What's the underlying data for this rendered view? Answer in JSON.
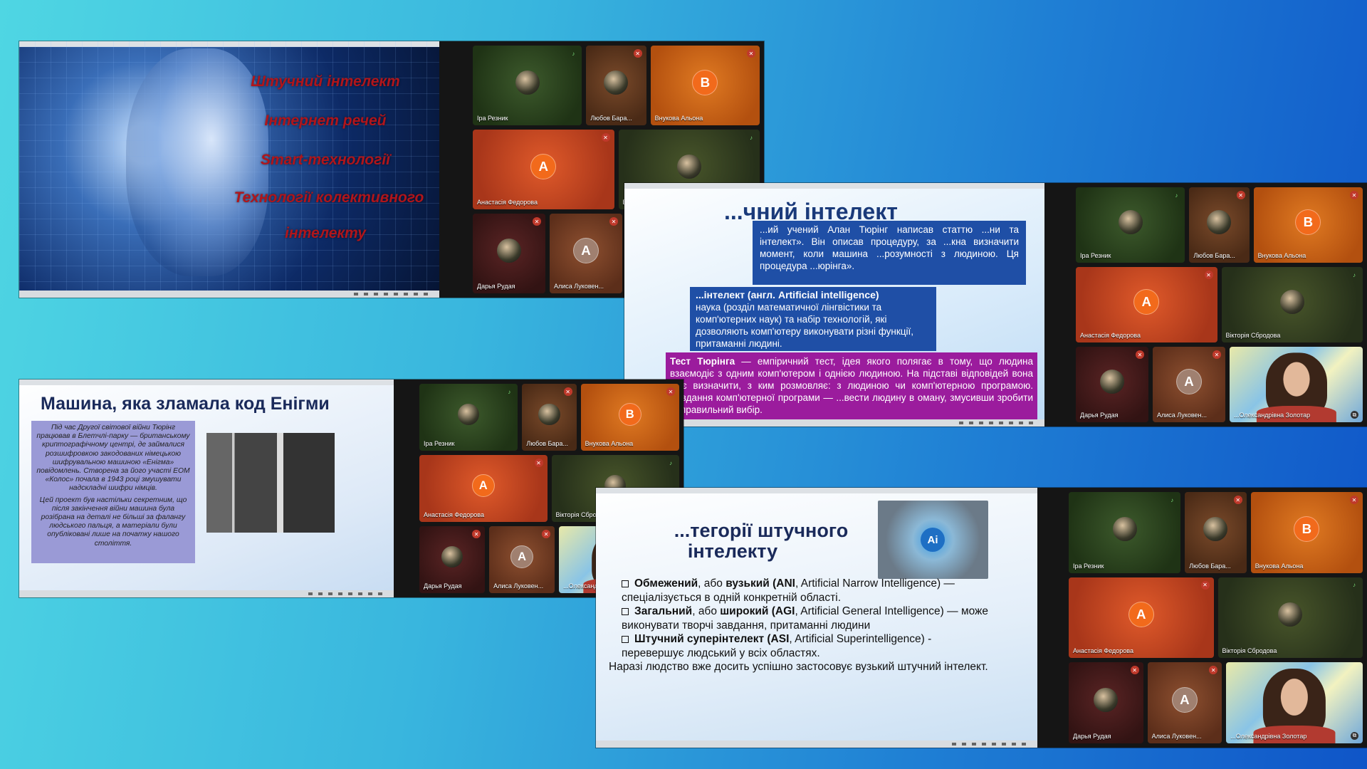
{
  "participants": [
    {
      "name": "Іра Резник",
      "color": "green",
      "kind": "photo",
      "mic": "on"
    },
    {
      "name": "Любов Бара...",
      "color": "brown",
      "kind": "photo",
      "mic": "off"
    },
    {
      "name": "Внукова Альона",
      "color": "orange",
      "kind": "letter",
      "letter": "В",
      "mic": "off"
    },
    {
      "name": "Анастасія Федорова",
      "color": "red",
      "kind": "letter",
      "letter": "А",
      "mic": "off"
    },
    {
      "name": "Вікторія Сбродова",
      "color": "olive",
      "kind": "photo",
      "mic": "on"
    },
    {
      "name": "Дарья Рудая",
      "color": "maroon",
      "kind": "photo",
      "mic": "off"
    },
    {
      "name": "Алиса Луковен...",
      "color": "rust",
      "kind": "letter",
      "letter": "А",
      "mic": "off"
    },
    {
      "name": "...Олександрівна Золотар",
      "color": "cam",
      "kind": "cam",
      "mic": "none"
    }
  ],
  "slide1": {
    "lines": [
      "Штучний інтелект",
      "Інтернет речей",
      "Smart-технології",
      "Технології колективного",
      "інтелекту"
    ]
  },
  "slide2": {
    "title": "...чний інтелект",
    "box1": "...ий учений Алан Тюрінг написав статтю ...ни та інтелект». Він описав процедуру, за ...кна визначити момент, коли машина ...розумності з людиною. Ця процедура ...юрінга».",
    "box2_title": "...інтелект (англ. Artificial intelligence)",
    "box2": "наука (розділ математичної лінгвістики та комп'ютерних наук) та набір технологій, які дозволяють комп'ютеру виконувати різні функції, притаманні людині.",
    "box3_title": "Тест Тюрінга",
    "box3": " — емпіричний тест, ідея якого полягає в тому, що людина взаємодіє з одним комп'ютером і однією людиною. На підставі відповідей вона має визначити, з ким розмовляє: з людиною чи комп'ютерною програмою. Завдання комп'ютерної програми — ...вести людину в оману, змусивши зробити неправильний вибір."
  },
  "slide3": {
    "title": "Машина, яка зламала код Енігми",
    "para1": "Під час Другої світової війни Тюрінг працював в Блетчлі-парку — британському криптографічному центрі, де займалися розшифровкою закодованих німецькою шифрувальною машиною «Енігма» повідомлень. Створена за його участі ЕОМ «Колос» почала в 1943 році змушувати надскладні шифри німців.",
    "para2": "Цей проект був настільки секретним, що після закінчення війни машина була розібрана на деталі не більші за фалангу людського пальця, а матеріали були опубліковані лише на початку нашого століття."
  },
  "slide4": {
    "title_line1": "...тегорії штучного",
    "title_line2": "інтелекту",
    "items": [
      {
        "bold": "Обмежений",
        "mid": ", або ",
        "bold2": "вузький (ANI",
        "rest": ", Artificial Narrow Intelligence) — спеціалізується в одній конкретній області."
      },
      {
        "bold": "Загальний",
        "mid": ", або ",
        "bold2": "широкий (AGI",
        "rest": ", Artificial General Intelligence) — може виконувати творчі завдання, притаманні людини"
      },
      {
        "bold": "Штучний суперінтелект (ASI",
        "mid": "",
        "bold2": "",
        "rest": ", Artificial Superintelligence) - перевершує людський у всіх областях."
      }
    ],
    "footer": "Наразі людство вже досить успішно застосовує вузький штучний інтелект."
  }
}
